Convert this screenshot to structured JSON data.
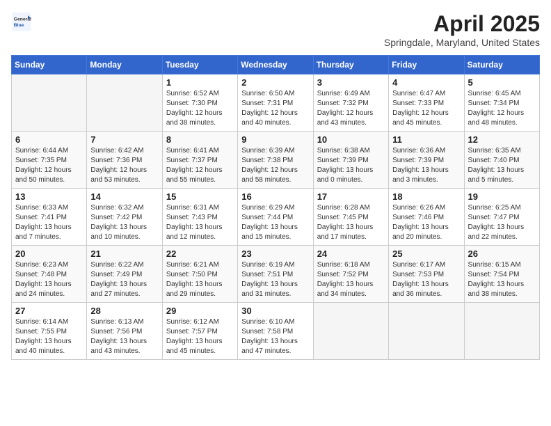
{
  "header": {
    "logo_general": "General",
    "logo_blue": "Blue",
    "month_year": "April 2025",
    "location": "Springdale, Maryland, United States"
  },
  "weekdays": [
    "Sunday",
    "Monday",
    "Tuesday",
    "Wednesday",
    "Thursday",
    "Friday",
    "Saturday"
  ],
  "weeks": [
    [
      {
        "day": "",
        "detail": ""
      },
      {
        "day": "",
        "detail": ""
      },
      {
        "day": "1",
        "detail": "Sunrise: 6:52 AM\nSunset: 7:30 PM\nDaylight: 12 hours and 38 minutes."
      },
      {
        "day": "2",
        "detail": "Sunrise: 6:50 AM\nSunset: 7:31 PM\nDaylight: 12 hours and 40 minutes."
      },
      {
        "day": "3",
        "detail": "Sunrise: 6:49 AM\nSunset: 7:32 PM\nDaylight: 12 hours and 43 minutes."
      },
      {
        "day": "4",
        "detail": "Sunrise: 6:47 AM\nSunset: 7:33 PM\nDaylight: 12 hours and 45 minutes."
      },
      {
        "day": "5",
        "detail": "Sunrise: 6:45 AM\nSunset: 7:34 PM\nDaylight: 12 hours and 48 minutes."
      }
    ],
    [
      {
        "day": "6",
        "detail": "Sunrise: 6:44 AM\nSunset: 7:35 PM\nDaylight: 12 hours and 50 minutes."
      },
      {
        "day": "7",
        "detail": "Sunrise: 6:42 AM\nSunset: 7:36 PM\nDaylight: 12 hours and 53 minutes."
      },
      {
        "day": "8",
        "detail": "Sunrise: 6:41 AM\nSunset: 7:37 PM\nDaylight: 12 hours and 55 minutes."
      },
      {
        "day": "9",
        "detail": "Sunrise: 6:39 AM\nSunset: 7:38 PM\nDaylight: 12 hours and 58 minutes."
      },
      {
        "day": "10",
        "detail": "Sunrise: 6:38 AM\nSunset: 7:39 PM\nDaylight: 13 hours and 0 minutes."
      },
      {
        "day": "11",
        "detail": "Sunrise: 6:36 AM\nSunset: 7:39 PM\nDaylight: 13 hours and 3 minutes."
      },
      {
        "day": "12",
        "detail": "Sunrise: 6:35 AM\nSunset: 7:40 PM\nDaylight: 13 hours and 5 minutes."
      }
    ],
    [
      {
        "day": "13",
        "detail": "Sunrise: 6:33 AM\nSunset: 7:41 PM\nDaylight: 13 hours and 7 minutes."
      },
      {
        "day": "14",
        "detail": "Sunrise: 6:32 AM\nSunset: 7:42 PM\nDaylight: 13 hours and 10 minutes."
      },
      {
        "day": "15",
        "detail": "Sunrise: 6:31 AM\nSunset: 7:43 PM\nDaylight: 13 hours and 12 minutes."
      },
      {
        "day": "16",
        "detail": "Sunrise: 6:29 AM\nSunset: 7:44 PM\nDaylight: 13 hours and 15 minutes."
      },
      {
        "day": "17",
        "detail": "Sunrise: 6:28 AM\nSunset: 7:45 PM\nDaylight: 13 hours and 17 minutes."
      },
      {
        "day": "18",
        "detail": "Sunrise: 6:26 AM\nSunset: 7:46 PM\nDaylight: 13 hours and 20 minutes."
      },
      {
        "day": "19",
        "detail": "Sunrise: 6:25 AM\nSunset: 7:47 PM\nDaylight: 13 hours and 22 minutes."
      }
    ],
    [
      {
        "day": "20",
        "detail": "Sunrise: 6:23 AM\nSunset: 7:48 PM\nDaylight: 13 hours and 24 minutes."
      },
      {
        "day": "21",
        "detail": "Sunrise: 6:22 AM\nSunset: 7:49 PM\nDaylight: 13 hours and 27 minutes."
      },
      {
        "day": "22",
        "detail": "Sunrise: 6:21 AM\nSunset: 7:50 PM\nDaylight: 13 hours and 29 minutes."
      },
      {
        "day": "23",
        "detail": "Sunrise: 6:19 AM\nSunset: 7:51 PM\nDaylight: 13 hours and 31 minutes."
      },
      {
        "day": "24",
        "detail": "Sunrise: 6:18 AM\nSunset: 7:52 PM\nDaylight: 13 hours and 34 minutes."
      },
      {
        "day": "25",
        "detail": "Sunrise: 6:17 AM\nSunset: 7:53 PM\nDaylight: 13 hours and 36 minutes."
      },
      {
        "day": "26",
        "detail": "Sunrise: 6:15 AM\nSunset: 7:54 PM\nDaylight: 13 hours and 38 minutes."
      }
    ],
    [
      {
        "day": "27",
        "detail": "Sunrise: 6:14 AM\nSunset: 7:55 PM\nDaylight: 13 hours and 40 minutes."
      },
      {
        "day": "28",
        "detail": "Sunrise: 6:13 AM\nSunset: 7:56 PM\nDaylight: 13 hours and 43 minutes."
      },
      {
        "day": "29",
        "detail": "Sunrise: 6:12 AM\nSunset: 7:57 PM\nDaylight: 13 hours and 45 minutes."
      },
      {
        "day": "30",
        "detail": "Sunrise: 6:10 AM\nSunset: 7:58 PM\nDaylight: 13 hours and 47 minutes."
      },
      {
        "day": "",
        "detail": ""
      },
      {
        "day": "",
        "detail": ""
      },
      {
        "day": "",
        "detail": ""
      }
    ]
  ]
}
